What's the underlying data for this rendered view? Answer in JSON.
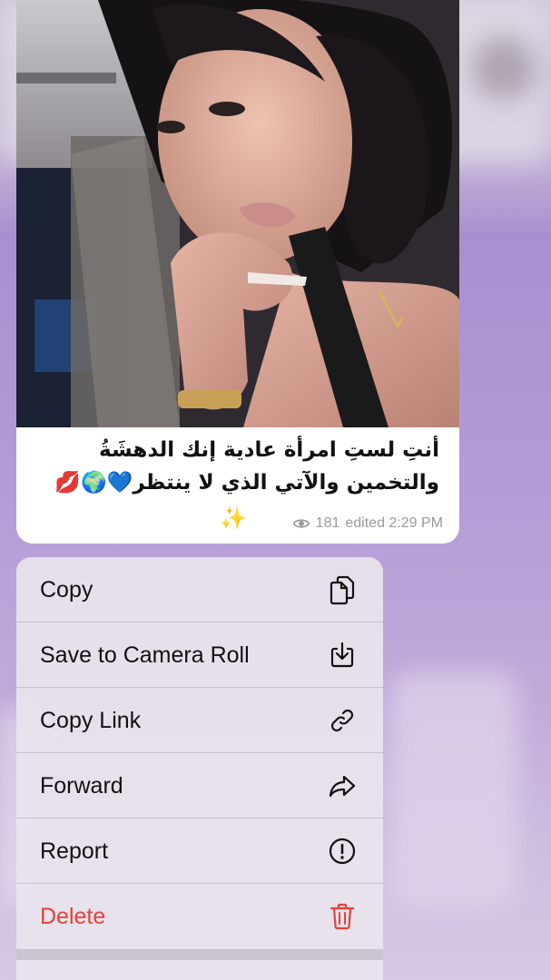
{
  "message": {
    "caption_line1": "أنتِ لستِ امرأة عادية إنك الدهشَةُ",
    "caption_line2": "والتخمين والآتي الذي لا ينتظر💙🌍💋",
    "sparkle": "✨",
    "views": "181",
    "edited_time": "edited 2:29 PM",
    "photo_icon": "photo-of-woman"
  },
  "context_menu": {
    "items": [
      {
        "label": "Copy",
        "icon": "copy-icon"
      },
      {
        "label": "Save to Camera Roll",
        "icon": "download-icon"
      },
      {
        "label": "Copy Link",
        "icon": "link-icon"
      },
      {
        "label": "Forward",
        "icon": "forward-icon"
      },
      {
        "label": "Report",
        "icon": "report-icon"
      },
      {
        "label": "Delete",
        "icon": "trash-icon",
        "color": "#e5413b"
      }
    ]
  },
  "colors": {
    "danger": "#e5413b",
    "background_purple": "#a98fd0"
  }
}
